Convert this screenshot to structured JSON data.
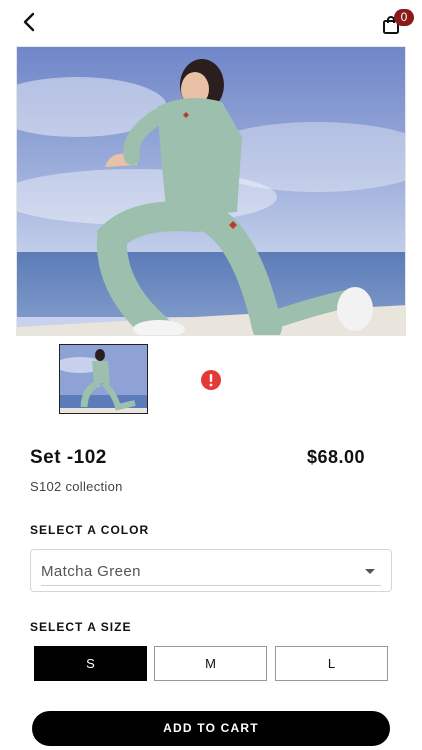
{
  "header": {
    "cart_count": "0",
    "back_icon": "chevron-left-icon",
    "cart_icon": "shopping-bag-icon"
  },
  "gallery": {
    "thumbnail_count": 1,
    "error_icon": "alert-circle-icon",
    "error_color": "#e53935"
  },
  "product": {
    "title": "Set -102",
    "price": "$68.00",
    "collection": "S102 collection"
  },
  "color": {
    "label": "SELECT A COLOR",
    "selected": "Matcha Green"
  },
  "size": {
    "label": "SELECT A SIZE",
    "options": [
      "S",
      "M",
      "L"
    ],
    "selected": "S"
  },
  "actions": {
    "add_to_cart": "ADD TO CART"
  },
  "colors": {
    "accent": "#000000",
    "badge": "#8b1a1a",
    "outfit": "#9cbfae"
  }
}
